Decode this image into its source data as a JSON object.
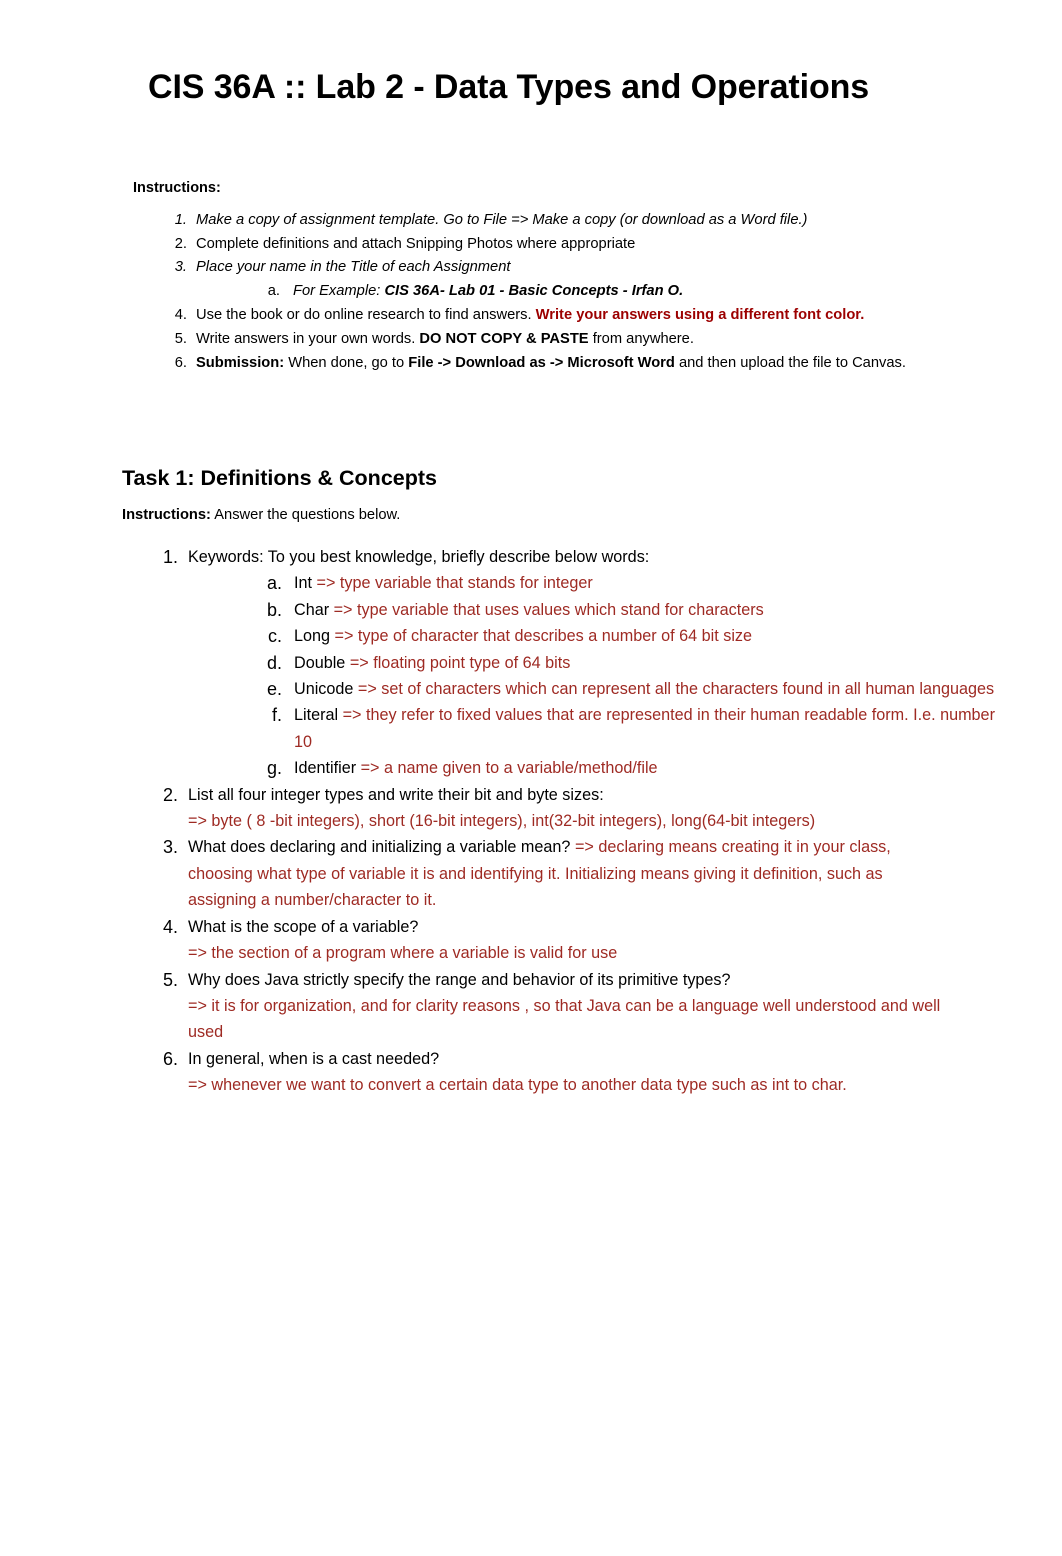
{
  "document": {
    "title": "CIS 36A :: Lab 2 - Data Types and Operations",
    "colors": {
      "answer_red": "#9E2A23",
      "emphasis_red": "#9C0000",
      "body_black": "#000000"
    }
  },
  "instructions": {
    "heading": "Instructions:",
    "items": [
      {
        "marker": "1.",
        "text": "Make a copy of assignment template. Go to File => Make a copy (or download as a Word file.)"
      },
      {
        "marker": "2.",
        "text": "Complete definitions and attach Snipping Photos where appropriate"
      },
      {
        "marker": "3.",
        "text": "Place your name in the Title of each Assignment",
        "sub": {
          "marker": "a.",
          "label": "For Example:",
          "example": "CIS 36A- Lab 01 - Basic Concepts - Irfan O."
        }
      },
      {
        "marker": "4.",
        "text": "Use the book or do online research to find answers.",
        "emphasis": "Write your answers using a different font color."
      },
      {
        "marker": "5.",
        "lead": "Write answers in your own words.",
        "bold": "DO NOT COPY & PASTE",
        "tail": "from anywhere."
      },
      {
        "marker": "6.",
        "bold_lead": "Submission:",
        "lead": "When done, go to",
        "bold": "File -> Download as -> Microsoft Word",
        "tail": "and then upload the file to Canvas."
      }
    ]
  },
  "task1": {
    "heading": "Task 1: Definitions & Concepts",
    "instructions_label": "Instructions:",
    "instructions_text": "Answer the questions below.",
    "questions": [
      {
        "marker": "1.",
        "prompt": "Keywords: To you best knowledge, briefly describe below words:",
        "keywords": [
          {
            "marker": "a.",
            "term": "Int",
            "answer": "=> type variable that stands for integer"
          },
          {
            "marker": "b.",
            "term": "Char",
            "answer": "=> type variable that uses values which stand for characters"
          },
          {
            "marker": "c.",
            "term": "Long",
            "answer": "=> type of character that describes a number of 64 bit size"
          },
          {
            "marker": "d.",
            "term": "Double",
            "answer": "=> floating point type of 64 bits"
          },
          {
            "marker": "e.",
            "term": "Unicode",
            "answer": "=> set of characters which can represent all the characters found in all human languages"
          },
          {
            "marker": "f.",
            "term": "Literal",
            "answer": "=> they refer to fixed values that are represented in their human readable form. I.e. number 10"
          },
          {
            "marker": "g.",
            "term": "Identifier",
            "answer": "=> a name given to a variable/method/file"
          }
        ]
      },
      {
        "marker": "2.",
        "prompt": "List all four integer types and write their bit and byte sizes:",
        "answer": "=> byte ( 8 -bit integers), short (16-bit integers), int(32-bit integers), long(64-bit integers)",
        "answer_inline": false
      },
      {
        "marker": "3.",
        "prompt": "What does declaring and initializing a variable mean?",
        "answer": "=> declaring means creating it in your class, choosing what type of variable it is and identifying it. Initializing means giving it definition, such as assigning a number/character to it.",
        "answer_inline": true
      },
      {
        "marker": "4.",
        "prompt": "What is the scope of a variable?",
        "answer": "=> the section of a program where a variable is valid for use",
        "answer_inline": false
      },
      {
        "marker": "5.",
        "prompt": "Why does Java strictly specify the range and behavior of its primitive types?",
        "answer": "=> it is for organization, and for clarity reasons , so that Java can be a language well understood and well used",
        "answer_inline": false
      },
      {
        "marker": "6.",
        "prompt": "In general, when is a cast needed?",
        "answer": "=> whenever we want to convert a certain data type to another data type such as int to char.",
        "answer_inline": false
      }
    ]
  }
}
